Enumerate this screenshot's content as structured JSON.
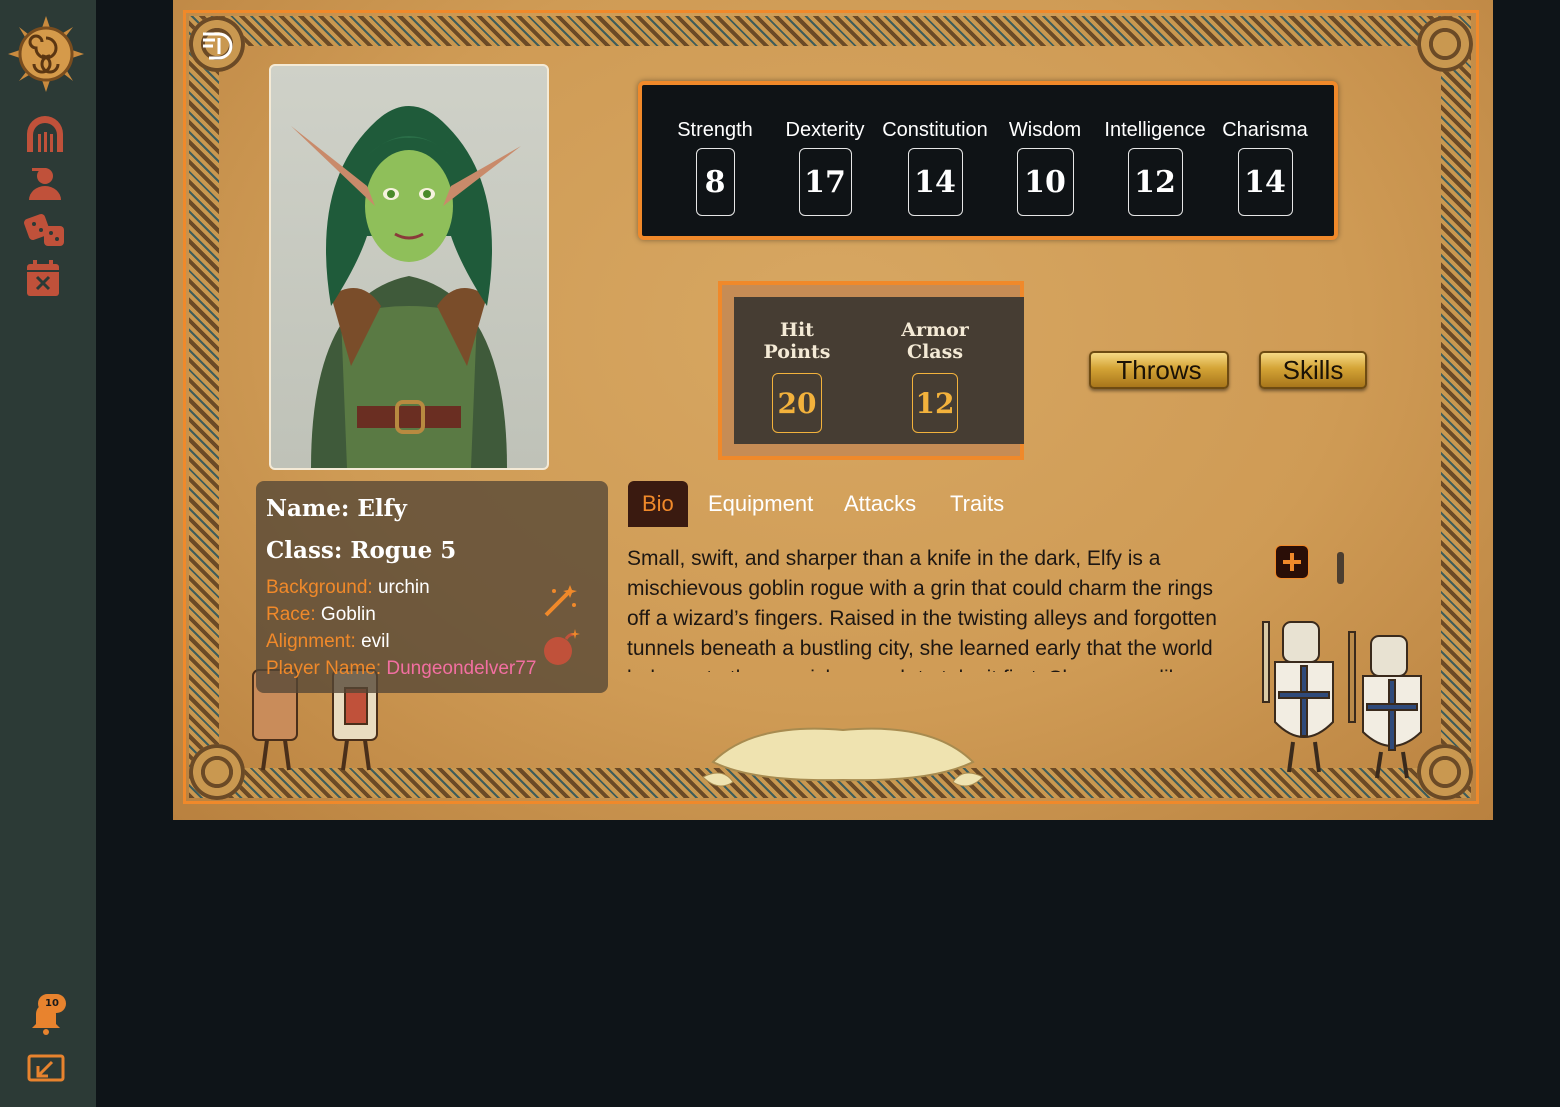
{
  "sidebar": {
    "icons": [
      "sun-spiral-logo",
      "portal-icon",
      "character-icon",
      "dice-icon",
      "calendar-x-icon"
    ],
    "notification_count": "10",
    "back_icon": "exit-icon"
  },
  "colors": {
    "accent": "#f0892a",
    "sidebar_bg": "#2c3a36",
    "page_bg": "#0e1418",
    "vital_gold": "#f3b23c",
    "player_name": "#f26fa1"
  },
  "abilities": [
    {
      "label": "Strength",
      "value": "8"
    },
    {
      "label": "Dexterity",
      "value": "17"
    },
    {
      "label": "Constitution",
      "value": "14"
    },
    {
      "label": "Wisdom",
      "value": "10"
    },
    {
      "label": "Intelligence",
      "value": "12"
    },
    {
      "label": "Charisma",
      "value": "14"
    }
  ],
  "vitals": {
    "hit_points_label": "Hit Points",
    "hit_points": "20",
    "armor_class_label": "Armor Class",
    "armor_class": "12"
  },
  "buttons": {
    "throws": "Throws",
    "skills": "Skills"
  },
  "info": {
    "name": "Name: Elfy",
    "class": "Class: Rogue 5",
    "background_label": "Background:",
    "background": "urchin",
    "race_label": "Race:",
    "race": "Goblin",
    "alignment_label": "Alignment:",
    "alignment": "evil",
    "player_label": "Player Name:",
    "player": "Dungeondelver77"
  },
  "tabs": [
    {
      "label": "Bio",
      "active": true
    },
    {
      "label": "Equipment",
      "active": false
    },
    {
      "label": "Attacks",
      "active": false
    },
    {
      "label": "Traits",
      "active": false
    }
  ],
  "bio_text": "Small, swift, and sharper than a knife in the dark, Elfy is a mischievous goblin rogue with a grin that could charm the rings off a wizard’s fingers. Raised in the twisting alleys and forgotten tunnels beneath a bustling city, she learned early that the world belongs to those quick enough to take it first. She moves like a shadow and laughs like trouble."
}
